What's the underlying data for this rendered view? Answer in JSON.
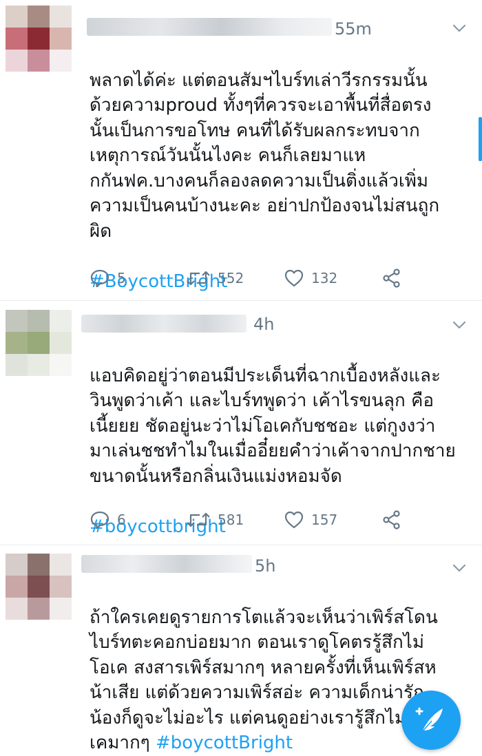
{
  "colors": {
    "link": "#1da1f2",
    "muted": "#657786",
    "text": "#14171a"
  },
  "tweets": [
    {
      "time": "55m",
      "text": "พลาดได้ค่ะ แต่ตอนสัมฯไบร์ทเล่าวีรกรรมนั้น\nด้วยความproud ทั้งๆที่ควรจะเอาพื้นที่สื่อตรง\nนั้นเป็นการขอโทษ คนที่ได้รับผลกระทบจาก\nเหตุการณ์วันนั้นไงคะ คนก็เลยมาแห\nกกันฟค.บางคนก็ลองลดความเป็นติ่งแล้วเพิ่ม\nความเป็นคนบ้างนะคะ อย่าปกป้องจนไม่สนถูก\nผิด",
      "hashtag": "#BoycottBright",
      "replies": "5",
      "retweets": "552",
      "likes": "132"
    },
    {
      "time": "4h",
      "text": "แอบคิดอยู่ว่าตอนมีประเด็นที่ฉากเบื้องหลังและ\nวินพูดว่าเค้า และไบร์ทพูดว่า เค้าไรขนลุก คือ\nเนี้ยยย ชัดอยู่นะว่าไม่โอเคกับชชอะ แต่กูงงว่า\nมาเล่นชชทำไมในเมื่ออี๋ยยคำว่าเค้าจากปากชาย\nขนาดนั้นหรือกลิ่นเงินแม่งหอมจัด",
      "hashtag": "#boycottbright",
      "replies": "6",
      "retweets": "581",
      "likes": "157"
    },
    {
      "time": "5h",
      "text": "ถ้าใครเคยดูรายการโตแล้วจะเห็นว่าเพิร์สโดน\nไบร์ทตะคอกบ่อยมาก ตอนเราดูโคตรรู้สึกไม่\nโอเค สงสารเพิร์สมากๆ หลายครั้งที่เห็นเพิร์สห\nน้าเสีย แต่ด้วยความเพิร์สอ่ะ ความเด็กน่ารัก\nน้องก็ดูจะไม่อะไร แต่คนดูอย่างเรารู้สึกไม่โอ\nเคมากๆ",
      "hashtag": "#boycottBright"
    }
  ]
}
